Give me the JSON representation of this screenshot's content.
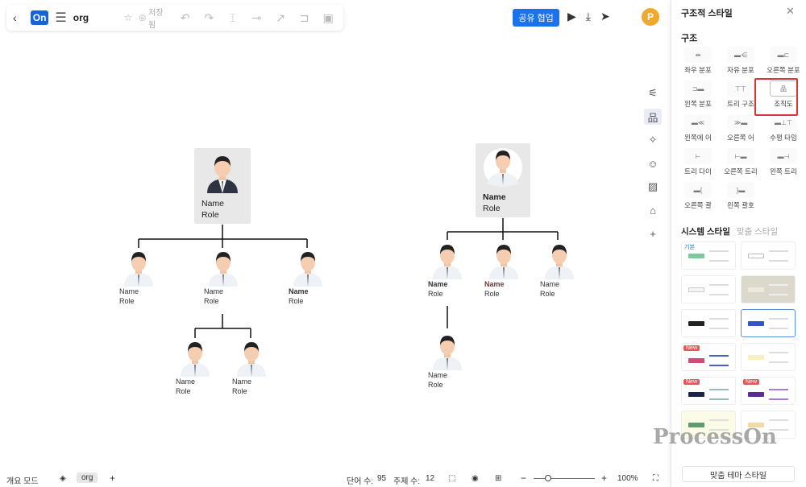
{
  "toolbar": {
    "back": "‹",
    "logo": "On",
    "doc_title": "org",
    "saved": "저장됨",
    "share_label": "공유 협업",
    "avatar_letter": "P"
  },
  "panel": {
    "title": "구조적 스타일",
    "structure_section": "구조",
    "structures": [
      {
        "label": "좌우 분포"
      },
      {
        "label": "자유 분포"
      },
      {
        "label": "오른쪽 분포"
      },
      {
        "label": "왼쪽 분포"
      },
      {
        "label": "트리 구조"
      },
      {
        "label": "조직도"
      },
      {
        "label": "왼쪽에 어"
      },
      {
        "label": "오른쪽 어"
      },
      {
        "label": "수평 타임"
      },
      {
        "label": "트리 다이"
      },
      {
        "label": "오른쪽 트리"
      },
      {
        "label": "왼쪽 트리"
      },
      {
        "label": "오른쪽 괄"
      },
      {
        "label": "왼쪽 괄호"
      }
    ],
    "tab_system": "시스템 스타일",
    "tab_custom": "맞춤 스타일",
    "theme_first_label": "기본",
    "new_badge": "New",
    "custom_theme_button": "맞춤 테마 스타일",
    "watermark": "ProcessOn"
  },
  "org_left": {
    "root": {
      "name": "Name",
      "role": "Role"
    },
    "children": [
      {
        "name": "Name",
        "role": "Role"
      },
      {
        "name": "Name",
        "role": "Role"
      },
      {
        "name": "Name",
        "role": "Role"
      }
    ],
    "grandchildren": [
      {
        "name": "Name",
        "role": "Role"
      },
      {
        "name": "Name",
        "role": "Role"
      }
    ]
  },
  "org_right": {
    "root": {
      "name": "Name",
      "role": "Role"
    },
    "children": [
      {
        "name": "Name",
        "role": "Role"
      },
      {
        "name": "Name",
        "role": "Role"
      },
      {
        "name": "Name",
        "role": "Role"
      }
    ],
    "grandchild": {
      "name": "Name",
      "role": "Role"
    }
  },
  "status": {
    "outline_mode": "개요 모드",
    "page_tab": "org",
    "word_count_label": "단어 수:",
    "word_count": "95",
    "topic_count_label": "주제 수:",
    "topic_count": "12",
    "zoom": "100%"
  },
  "colors": {
    "accent": "#1a73e8",
    "avatar": "#f0a92c",
    "highlight": "#d33333",
    "new_badge": "#e2575a"
  }
}
